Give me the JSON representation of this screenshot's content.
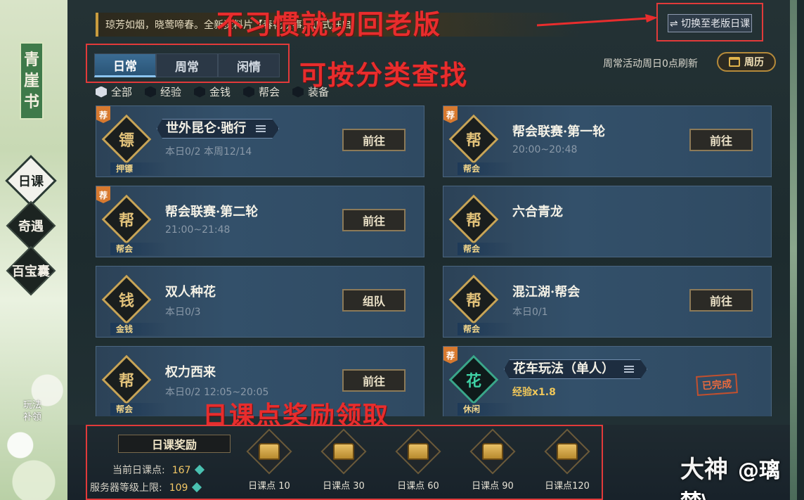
{
  "sidebar": {
    "book_title": [
      "青",
      "崖",
      "书"
    ],
    "nav": [
      {
        "label": "日课",
        "active": true
      },
      {
        "label": "奇遇",
        "active": false
      },
      {
        "label": "百宝囊",
        "active": false
      }
    ],
    "bushi": [
      "玩法",
      "补领"
    ]
  },
  "notice": "琼芳如烟，晓莺啼春。全新资料片【春花秋事】正式开启",
  "switch_button": "⇌ 切换至老版日课",
  "annotations": {
    "switch": "不习惯就切回老版",
    "tabs": "可按分类查找",
    "reward": "日课点奖励领取"
  },
  "tabs": [
    {
      "label": "日常",
      "active": true
    },
    {
      "label": "周常",
      "active": false
    },
    {
      "label": "闲情",
      "active": false
    }
  ],
  "refresh_note": "周常活动周日0点刷新",
  "calendar_button": "周历",
  "filters": [
    {
      "label": "全部",
      "active": true
    },
    {
      "label": "经验",
      "active": false
    },
    {
      "label": "金钱",
      "active": false
    },
    {
      "label": "帮会",
      "active": false
    },
    {
      "label": "装备",
      "active": false
    }
  ],
  "cards": [
    {
      "title": "世外昆仑·驰行",
      "sub": "本日0/2  本周12/14",
      "tag": "押镖",
      "badge": "荐",
      "glyph": "镖",
      "button": "前往",
      "pill": true
    },
    {
      "title": "帮会联赛·第一轮",
      "sub": "20:00~20:48",
      "tag": "帮会",
      "badge": "荐",
      "glyph": "帮",
      "button": "前往"
    },
    {
      "title": "帮会联赛·第二轮",
      "sub": "21:00~21:48",
      "tag": "帮会",
      "badge": "荐",
      "glyph": "帮",
      "button": "前往"
    },
    {
      "title": "六合青龙",
      "sub": "",
      "tag": "帮会",
      "badge": "",
      "glyph": "帮",
      "button": ""
    },
    {
      "title": "双人种花",
      "sub": "本日0/3",
      "tag": "金钱",
      "badge": "",
      "glyph": "钱",
      "button": "组队"
    },
    {
      "title": "混江湖·帮会",
      "sub": "本日0/1",
      "tag": "帮会",
      "badge": "",
      "glyph": "帮",
      "button": "前往"
    },
    {
      "title": "权力西来",
      "sub": "本日0/2  12:05~20:05",
      "tag": "帮会",
      "badge": "",
      "glyph": "帮",
      "button": "前往"
    },
    {
      "title": "花车玩法（单人）",
      "sub": "经验x1.8",
      "tag": "休闲",
      "badge": "荐",
      "glyph": "花",
      "button": "",
      "done": "已完成",
      "pill": true,
      "green": true
    }
  ],
  "reward": {
    "title": "日课奖励",
    "current_label": "当前日课点:",
    "current_value": "167",
    "limit_label": "服务器等级上限:",
    "limit_value": "109",
    "chests": [
      "日课点 10",
      "日课点 30",
      "日课点 60",
      "日课点 90",
      "日课点120"
    ]
  },
  "watermark": {
    "logo": "大神",
    "handle": "@璃梦\\"
  }
}
